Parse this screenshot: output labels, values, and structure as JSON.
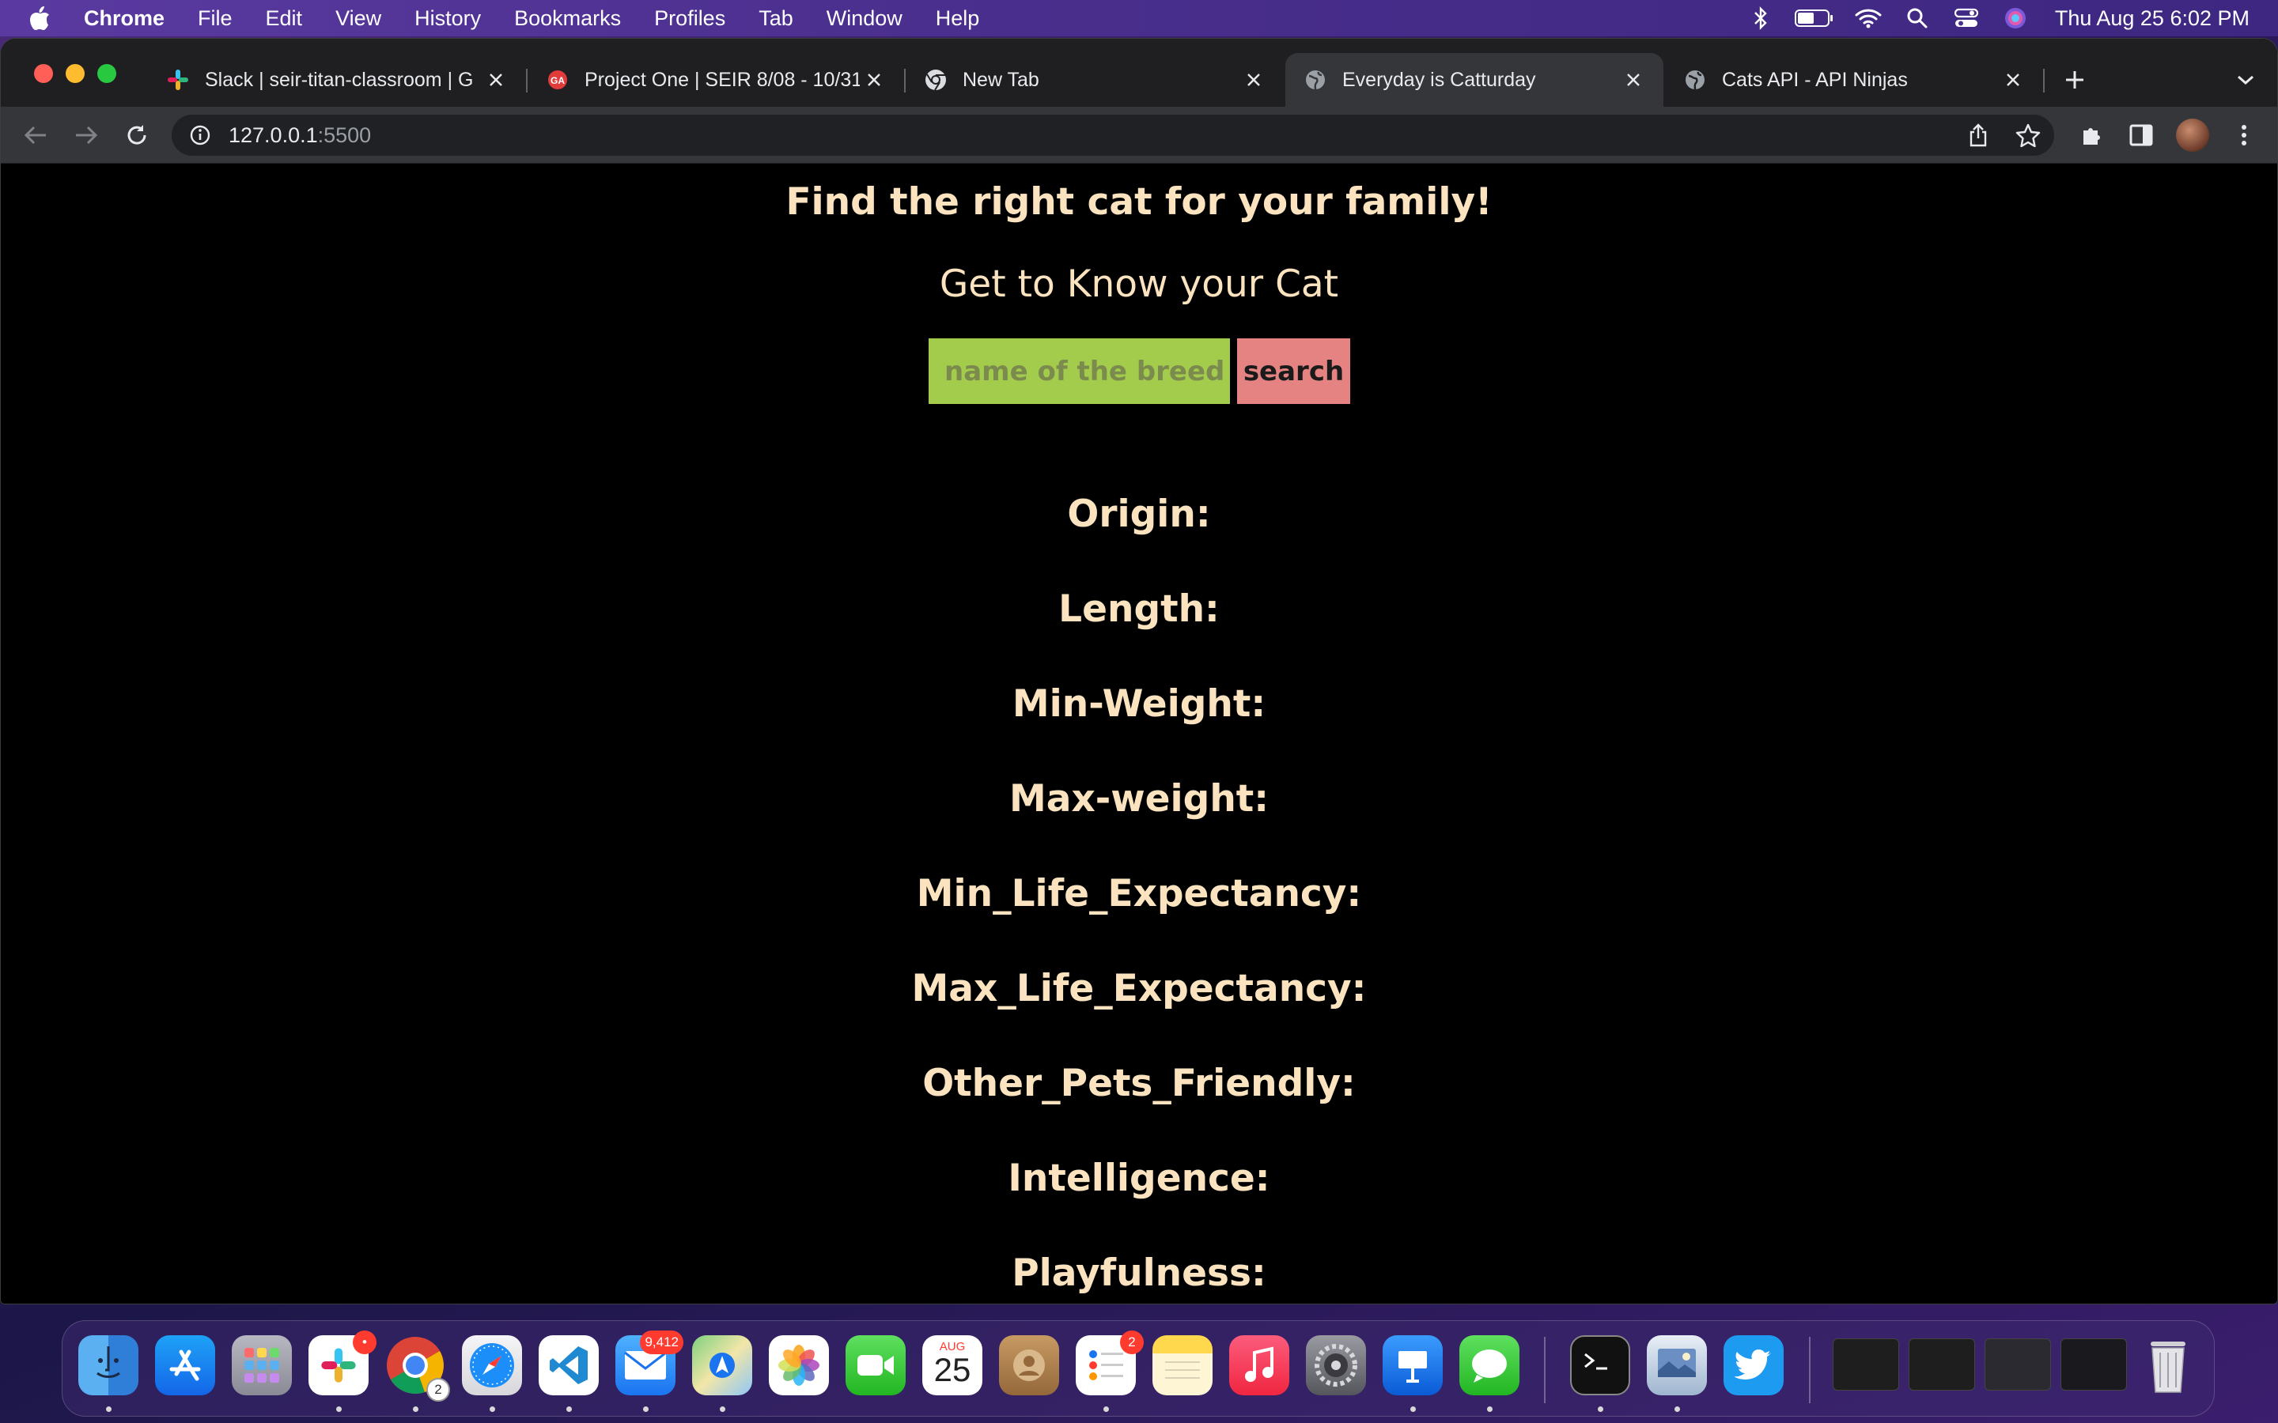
{
  "menubar": {
    "app_name": "Chrome",
    "items": [
      "File",
      "Edit",
      "View",
      "History",
      "Bookmarks",
      "Profiles",
      "Tab",
      "Window",
      "Help"
    ],
    "clock": "Thu Aug 25  6:02 PM"
  },
  "tabs": [
    {
      "title": "Slack | seir-titan-classroom | G",
      "icon": "slack-icon",
      "active": false
    },
    {
      "title": "Project One | SEIR 8/08 - 10/31",
      "icon": "ga-icon",
      "active": false
    },
    {
      "title": "New Tab",
      "icon": "chrome-icon",
      "active": false
    },
    {
      "title": "Everyday is Catturday",
      "icon": "globe-icon",
      "active": true
    },
    {
      "title": "Cats API - API Ninjas",
      "icon": "globe-icon",
      "active": false
    }
  ],
  "address_bar": {
    "host": "127.0.0.1",
    "port": ":5500"
  },
  "page": {
    "title": "Find the right cat for your family!",
    "subtitle": "Get to Know your Cat",
    "search_placeholder": "name of the breed",
    "search_button": "search",
    "fields": [
      "Origin:",
      "Length:",
      "Min-Weight:",
      "Max-weight:",
      "Min_Life_Expectancy:",
      "Max_Life_Expectancy:",
      "Other_Pets_Friendly:",
      "Intelligence:",
      "Playfulness:"
    ]
  },
  "dock": {
    "slack_badge": "•",
    "chrome_badge": "2",
    "mail_badge": "9,412",
    "calendar_month": "AUG",
    "calendar_day": "25",
    "reminders_badge": "2"
  },
  "colors": {
    "page_text": "#fbe3bf",
    "search_input_bg": "#a3cc4d",
    "search_button_bg": "#e58383",
    "page_bg": "#000000"
  }
}
